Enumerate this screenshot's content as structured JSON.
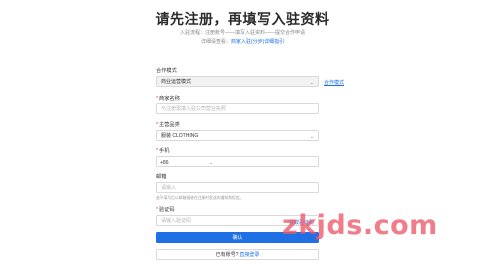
{
  "header": {
    "title": "请先注册，再填写入驻资料",
    "steps": "入驻流程：注册账号——填写入驻资料——提交合作申请",
    "guide_prefix": "详细请查看：",
    "guide_link": "商家入驻(分步)详细指引"
  },
  "form": {
    "cooperation_mode": {
      "label": "合作模式",
      "value": "商业运营模式",
      "side_link": "合作模式"
    },
    "shop_name": {
      "label": "商家名称",
      "placeholder": "与注册需填入驻公司营业执照"
    },
    "main_brand": {
      "label": "主营品类",
      "value": "服装 CLOTHING"
    },
    "phone": {
      "label": "手机",
      "country_code": "+86"
    },
    "email": {
      "label": "邮箱",
      "placeholder": "请输入",
      "hint": "选不填写后以邮箱接收在注册时发送的通知和短信。"
    },
    "verify_code": {
      "label": "验证码",
      "placeholder": "请输入验证码",
      "button": "获取验证码"
    },
    "submit_label": "确认",
    "login_prompt": "已有账号?",
    "login_link": "直接登录"
  },
  "watermark": "zkjds.com",
  "colors": {
    "accent": "#1f6fe5",
    "required": "#e33333",
    "watermark": "#ec5868"
  },
  "icons": [
    "chevron-down-icon"
  ]
}
